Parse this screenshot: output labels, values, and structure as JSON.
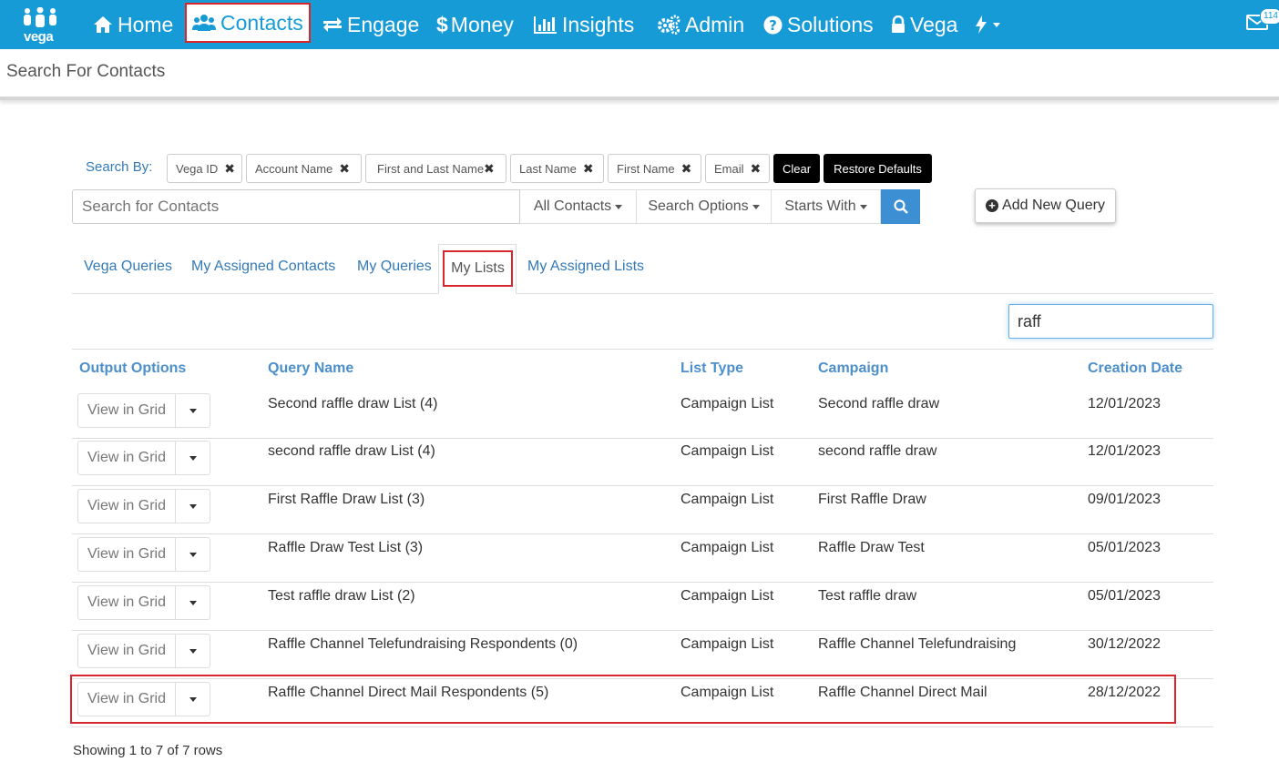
{
  "nav": {
    "logo_text": "vega",
    "items": [
      {
        "label": "Home",
        "icon": "home-icon"
      },
      {
        "label": "Contacts",
        "icon": "users-icon"
      },
      {
        "label": "Engage",
        "icon": "exchange-icon"
      },
      {
        "label": "Money",
        "icon": "dollar-icon"
      },
      {
        "label": "Insights",
        "icon": "bar-chart-icon"
      },
      {
        "label": "Admin",
        "icon": "cogs-icon"
      },
      {
        "label": "Solutions",
        "icon": "question-circle-icon"
      },
      {
        "label": "Vega",
        "icon": "lock-icon"
      },
      {
        "label": "",
        "icon": "bolt-icon"
      }
    ],
    "mail_count": "114"
  },
  "page": {
    "title": "Search For Contacts"
  },
  "search_by": {
    "label": "Search By:",
    "chips": [
      "Vega ID",
      "Account Name",
      "First and Last Name",
      "Last Name",
      "First Name",
      "Email"
    ],
    "clear_label": "Clear",
    "restore_label": "Restore Defaults"
  },
  "search": {
    "placeholder": "Search for Contacts",
    "scope": "All Contacts",
    "options": "Search Options",
    "match": "Starts With",
    "add_query": "Add New Query"
  },
  "tabs": [
    "Vega Queries",
    "My Assigned Contacts",
    "My Queries",
    "My Lists",
    "My Assigned Lists"
  ],
  "active_tab": "My Lists",
  "filter_value": "raff",
  "table": {
    "headers": [
      "Output Options",
      "Query Name",
      "List Type",
      "Campaign",
      "Creation Date"
    ],
    "view_label": "View in Grid",
    "rows": [
      {
        "name": "Second raffle draw List (4)",
        "type": "Campaign List",
        "campaign": "Second raffle draw",
        "date": "12/01/2023"
      },
      {
        "name": "second raffle draw List (4)",
        "type": "Campaign List",
        "campaign": "second raffle draw",
        "date": "12/01/2023"
      },
      {
        "name": "First Raffle Draw List (3)",
        "type": "Campaign List",
        "campaign": "First Raffle Draw",
        "date": "09/01/2023"
      },
      {
        "name": "Raffle Draw Test List (3)",
        "type": "Campaign List",
        "campaign": "Raffle Draw Test",
        "date": "05/01/2023"
      },
      {
        "name": "Test raffle draw List (2)",
        "type": "Campaign List",
        "campaign": "Test raffle draw",
        "date": "05/01/2023"
      },
      {
        "name": "Raffle Channel Telefundraising Respondents (0)",
        "type": "Campaign List",
        "campaign": "Raffle Channel Telefundraising",
        "date": "30/12/2022"
      },
      {
        "name": "Raffle Channel Direct Mail Respondents (5)",
        "type": "Campaign List",
        "campaign": "Raffle Channel Direct Mail",
        "date": "28/12/2022"
      }
    ]
  },
  "footer": {
    "text": "Showing 1 to 7 of 7 rows"
  },
  "colors": {
    "brand": "#179bd7",
    "highlight": "#d9262c",
    "link": "#337ab7"
  }
}
